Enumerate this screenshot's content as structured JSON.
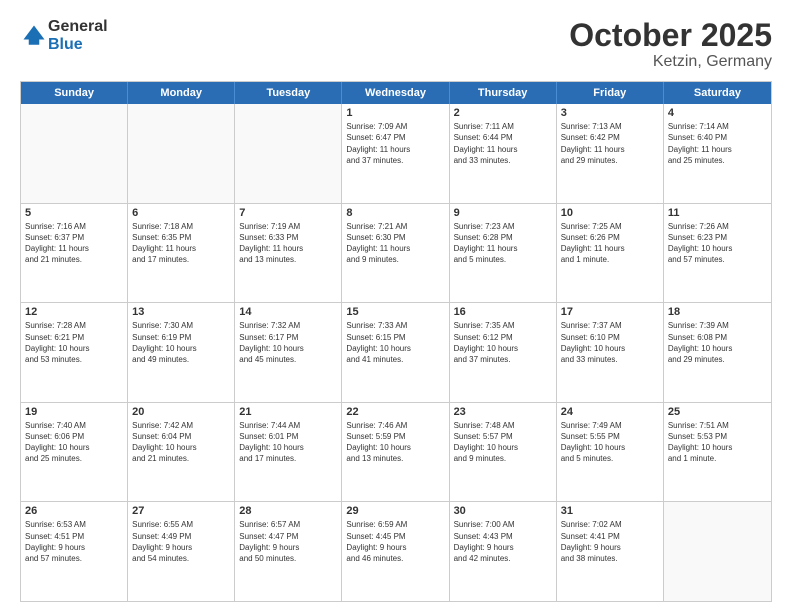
{
  "header": {
    "logo_general": "General",
    "logo_blue": "Blue",
    "month": "October 2025",
    "location": "Ketzin, Germany"
  },
  "days_of_week": [
    "Sunday",
    "Monday",
    "Tuesday",
    "Wednesday",
    "Thursday",
    "Friday",
    "Saturday"
  ],
  "weeks": [
    [
      {
        "day": "",
        "info": ""
      },
      {
        "day": "",
        "info": ""
      },
      {
        "day": "",
        "info": ""
      },
      {
        "day": "1",
        "info": "Sunrise: 7:09 AM\nSunset: 6:47 PM\nDaylight: 11 hours\nand 37 minutes."
      },
      {
        "day": "2",
        "info": "Sunrise: 7:11 AM\nSunset: 6:44 PM\nDaylight: 11 hours\nand 33 minutes."
      },
      {
        "day": "3",
        "info": "Sunrise: 7:13 AM\nSunset: 6:42 PM\nDaylight: 11 hours\nand 29 minutes."
      },
      {
        "day": "4",
        "info": "Sunrise: 7:14 AM\nSunset: 6:40 PM\nDaylight: 11 hours\nand 25 minutes."
      }
    ],
    [
      {
        "day": "5",
        "info": "Sunrise: 7:16 AM\nSunset: 6:37 PM\nDaylight: 11 hours\nand 21 minutes."
      },
      {
        "day": "6",
        "info": "Sunrise: 7:18 AM\nSunset: 6:35 PM\nDaylight: 11 hours\nand 17 minutes."
      },
      {
        "day": "7",
        "info": "Sunrise: 7:19 AM\nSunset: 6:33 PM\nDaylight: 11 hours\nand 13 minutes."
      },
      {
        "day": "8",
        "info": "Sunrise: 7:21 AM\nSunset: 6:30 PM\nDaylight: 11 hours\nand 9 minutes."
      },
      {
        "day": "9",
        "info": "Sunrise: 7:23 AM\nSunset: 6:28 PM\nDaylight: 11 hours\nand 5 minutes."
      },
      {
        "day": "10",
        "info": "Sunrise: 7:25 AM\nSunset: 6:26 PM\nDaylight: 11 hours\nand 1 minute."
      },
      {
        "day": "11",
        "info": "Sunrise: 7:26 AM\nSunset: 6:23 PM\nDaylight: 10 hours\nand 57 minutes."
      }
    ],
    [
      {
        "day": "12",
        "info": "Sunrise: 7:28 AM\nSunset: 6:21 PM\nDaylight: 10 hours\nand 53 minutes."
      },
      {
        "day": "13",
        "info": "Sunrise: 7:30 AM\nSunset: 6:19 PM\nDaylight: 10 hours\nand 49 minutes."
      },
      {
        "day": "14",
        "info": "Sunrise: 7:32 AM\nSunset: 6:17 PM\nDaylight: 10 hours\nand 45 minutes."
      },
      {
        "day": "15",
        "info": "Sunrise: 7:33 AM\nSunset: 6:15 PM\nDaylight: 10 hours\nand 41 minutes."
      },
      {
        "day": "16",
        "info": "Sunrise: 7:35 AM\nSunset: 6:12 PM\nDaylight: 10 hours\nand 37 minutes."
      },
      {
        "day": "17",
        "info": "Sunrise: 7:37 AM\nSunset: 6:10 PM\nDaylight: 10 hours\nand 33 minutes."
      },
      {
        "day": "18",
        "info": "Sunrise: 7:39 AM\nSunset: 6:08 PM\nDaylight: 10 hours\nand 29 minutes."
      }
    ],
    [
      {
        "day": "19",
        "info": "Sunrise: 7:40 AM\nSunset: 6:06 PM\nDaylight: 10 hours\nand 25 minutes."
      },
      {
        "day": "20",
        "info": "Sunrise: 7:42 AM\nSunset: 6:04 PM\nDaylight: 10 hours\nand 21 minutes."
      },
      {
        "day": "21",
        "info": "Sunrise: 7:44 AM\nSunset: 6:01 PM\nDaylight: 10 hours\nand 17 minutes."
      },
      {
        "day": "22",
        "info": "Sunrise: 7:46 AM\nSunset: 5:59 PM\nDaylight: 10 hours\nand 13 minutes."
      },
      {
        "day": "23",
        "info": "Sunrise: 7:48 AM\nSunset: 5:57 PM\nDaylight: 10 hours\nand 9 minutes."
      },
      {
        "day": "24",
        "info": "Sunrise: 7:49 AM\nSunset: 5:55 PM\nDaylight: 10 hours\nand 5 minutes."
      },
      {
        "day": "25",
        "info": "Sunrise: 7:51 AM\nSunset: 5:53 PM\nDaylight: 10 hours\nand 1 minute."
      }
    ],
    [
      {
        "day": "26",
        "info": "Sunrise: 6:53 AM\nSunset: 4:51 PM\nDaylight: 9 hours\nand 57 minutes."
      },
      {
        "day": "27",
        "info": "Sunrise: 6:55 AM\nSunset: 4:49 PM\nDaylight: 9 hours\nand 54 minutes."
      },
      {
        "day": "28",
        "info": "Sunrise: 6:57 AM\nSunset: 4:47 PM\nDaylight: 9 hours\nand 50 minutes."
      },
      {
        "day": "29",
        "info": "Sunrise: 6:59 AM\nSunset: 4:45 PM\nDaylight: 9 hours\nand 46 minutes."
      },
      {
        "day": "30",
        "info": "Sunrise: 7:00 AM\nSunset: 4:43 PM\nDaylight: 9 hours\nand 42 minutes."
      },
      {
        "day": "31",
        "info": "Sunrise: 7:02 AM\nSunset: 4:41 PM\nDaylight: 9 hours\nand 38 minutes."
      },
      {
        "day": "",
        "info": ""
      }
    ]
  ]
}
